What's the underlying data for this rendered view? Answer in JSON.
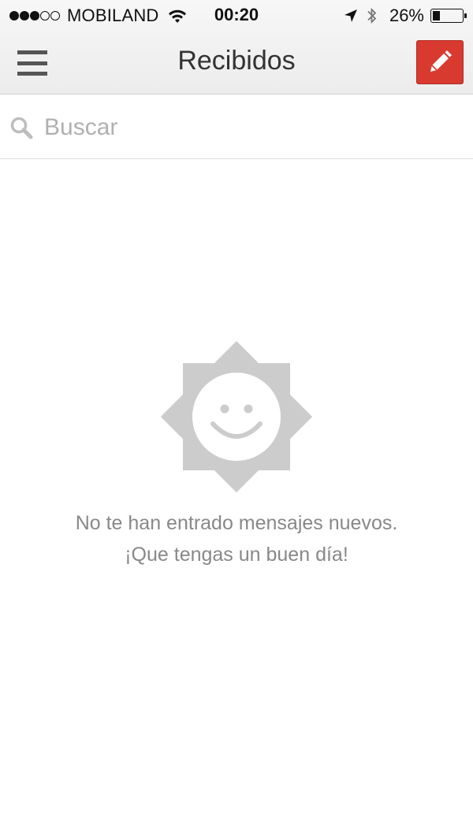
{
  "status_bar": {
    "carrier": "MOBILAND",
    "time": "00:20",
    "battery_percent": "26%",
    "battery_level": 0.26,
    "signal_bars_filled": 3,
    "signal_bars_total": 5
  },
  "header": {
    "title": "Recibidos",
    "menu_icon": "hamburger-menu-icon",
    "compose_icon": "pencil-icon"
  },
  "search": {
    "placeholder": "Buscar",
    "icon": "search-icon"
  },
  "empty_state": {
    "icon": "smiling-sun-icon",
    "line1": "No te han entrado mensajes nuevos.",
    "line2": "¡Que tengas un buen día!"
  },
  "colors": {
    "accent": "#d93a30",
    "empty_icon": "#cccccc",
    "muted_text": "#888888"
  }
}
